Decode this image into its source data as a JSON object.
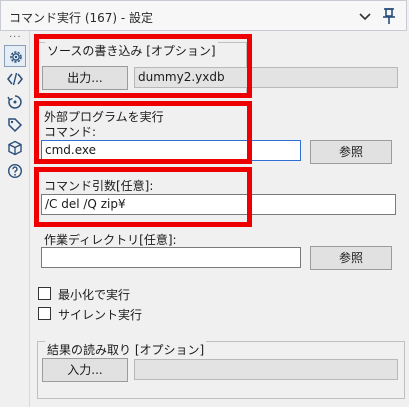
{
  "header": {
    "title": "コマンド実行 (167) - 設定",
    "icons": [
      "chevron-down-icon",
      "pin-icon"
    ]
  },
  "rail": {
    "dots": "...",
    "items": [
      "gear-icon",
      "xml-code-icon",
      "annotation-icon",
      "tag-icon",
      "cube-icon",
      "help-icon"
    ]
  },
  "write_source": {
    "title": "ソースの書き込み [オプション]",
    "output_button": "出力...",
    "output_file": "dummy2.yxdb"
  },
  "external_program": {
    "title": "外部プログラムを実行",
    "command_label": "コマンド:",
    "command_value": "cmd.exe",
    "browse_button": "参照",
    "args_label": "コマンド引数[任意]:",
    "args_value": "/C del /Q zip¥",
    "workdir_label": "作業ディレクトリ[任意]:",
    "workdir_value": "",
    "workdir_browse_button": "参照",
    "minimize_label": "最小化で実行",
    "minimize_checked": false,
    "silent_label": "サイレント実行",
    "silent_checked": false
  },
  "read_results": {
    "title": "結果の読み取り [オプション]",
    "input_button": "入力...",
    "input_file": ""
  },
  "colors": {
    "highlight": "#ee0000",
    "focus_border": "#2f6fd6"
  }
}
